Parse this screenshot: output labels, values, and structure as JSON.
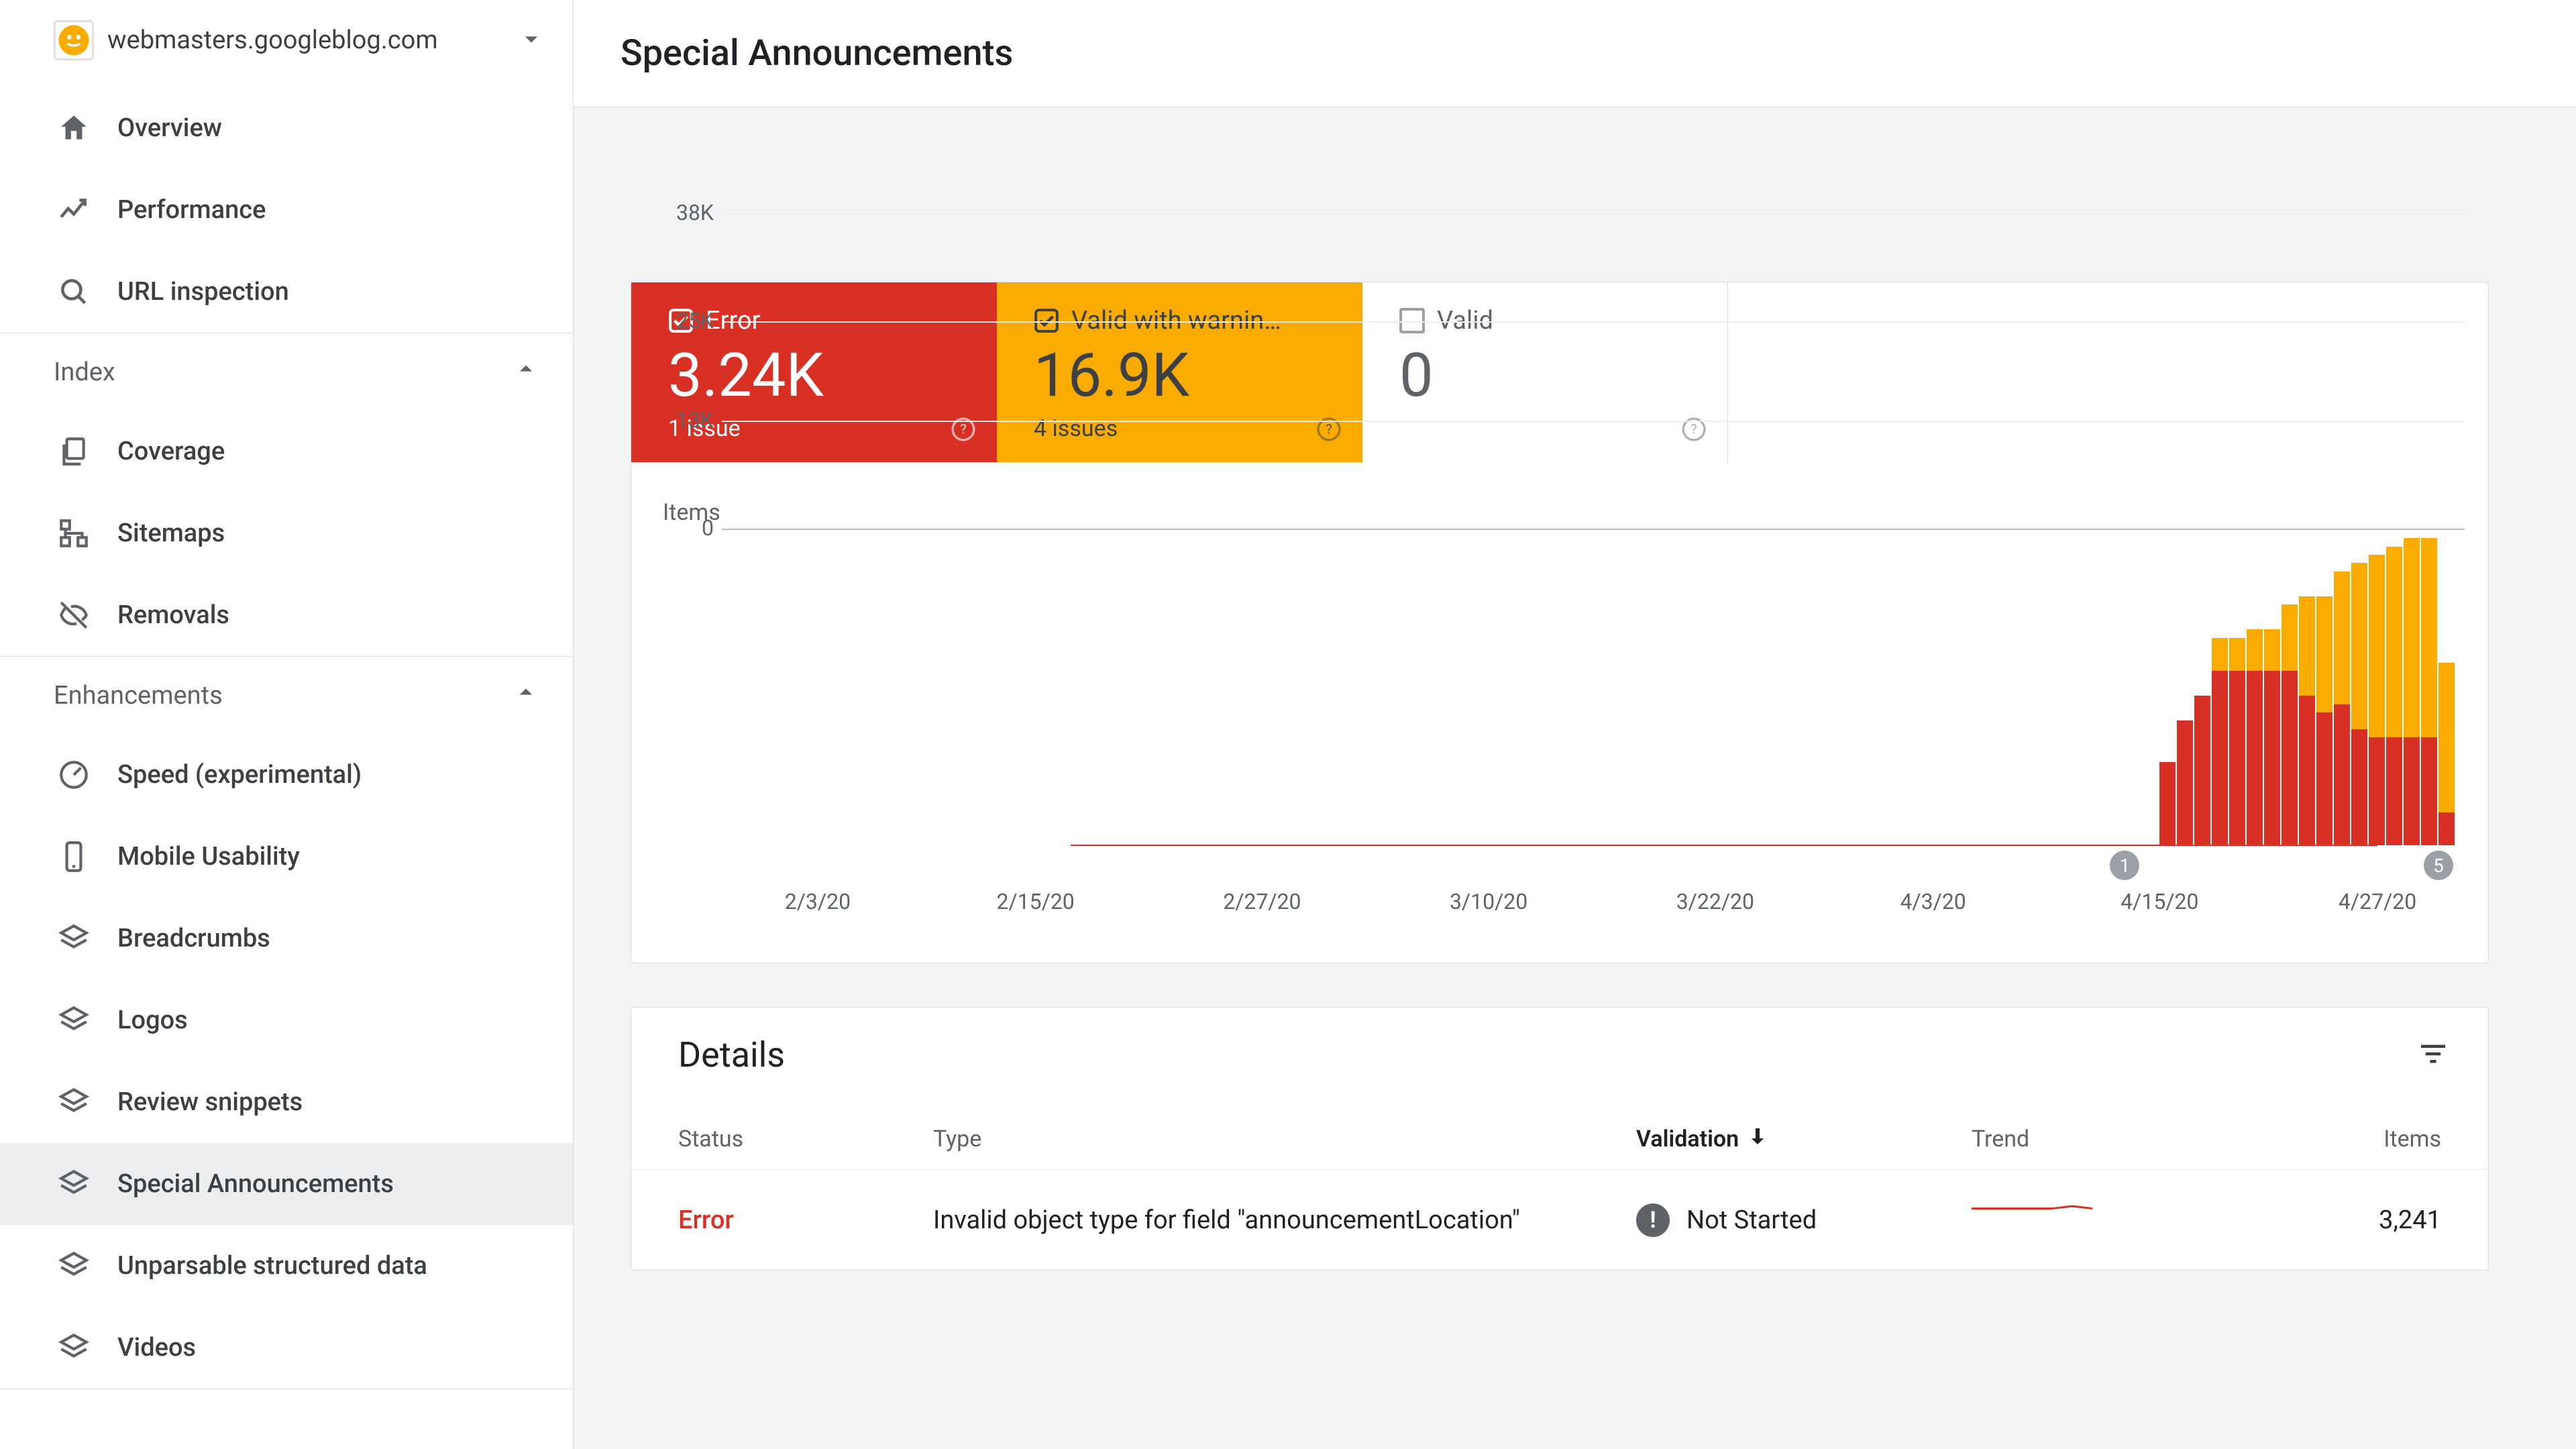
{
  "property": {
    "domain": "webmasters.googleblog.com"
  },
  "sidebar": {
    "primary": [
      {
        "id": "overview",
        "label": "Overview",
        "icon": "home"
      },
      {
        "id": "performance",
        "label": "Performance",
        "icon": "trend"
      },
      {
        "id": "url",
        "label": "URL inspection",
        "icon": "search"
      }
    ],
    "sections": [
      {
        "title": "Index",
        "items": [
          {
            "id": "coverage",
            "label": "Coverage",
            "icon": "pages"
          },
          {
            "id": "sitemaps",
            "label": "Sitemaps",
            "icon": "tree"
          },
          {
            "id": "removals",
            "label": "Removals",
            "icon": "hidden"
          }
        ]
      },
      {
        "title": "Enhancements",
        "items": [
          {
            "id": "speed",
            "label": "Speed (experimental)",
            "icon": "gauge"
          },
          {
            "id": "mobile",
            "label": "Mobile Usability",
            "icon": "phone"
          },
          {
            "id": "bread",
            "label": "Breadcrumbs",
            "icon": "layers"
          },
          {
            "id": "logos",
            "label": "Logos",
            "icon": "layers"
          },
          {
            "id": "review",
            "label": "Review snippets",
            "icon": "layers"
          },
          {
            "id": "special",
            "label": "Special Announcements",
            "icon": "layers",
            "active": true
          },
          {
            "id": "unparse",
            "label": "Unparsable structured data",
            "icon": "layers"
          },
          {
            "id": "videos",
            "label": "Videos",
            "icon": "layers"
          }
        ]
      }
    ]
  },
  "page": {
    "title": "Special Announcements"
  },
  "summary": {
    "error": {
      "label": "Error",
      "value": "3.24K",
      "sub": "1 issue",
      "checked": true
    },
    "warning": {
      "label": "Valid with warnin…",
      "value": "16.9K",
      "sub": "4 issues",
      "checked": true
    },
    "valid": {
      "label": "Valid",
      "value": "0",
      "sub": "",
      "checked": false
    }
  },
  "chart_data": {
    "type": "bar",
    "title": "",
    "ylabel": "Items",
    "ylim": [
      0,
      38000
    ],
    "yticks": [
      {
        "v": 0,
        "l": "0"
      },
      {
        "v": 13000,
        "l": "13K"
      },
      {
        "v": 25000,
        "l": "25K"
      },
      {
        "v": 38000,
        "l": "38K"
      }
    ],
    "categories_span": {
      "start": "2/3/20",
      "end": "4/30/20"
    },
    "xticks": [
      "2/3/20",
      "2/15/20",
      "2/27/20",
      "3/10/20",
      "3/22/20",
      "4/3/20",
      "4/15/20",
      "4/27/20"
    ],
    "xtick_positions_pct": [
      5.5,
      18,
      31,
      44,
      57,
      69.5,
      82.5,
      95
    ],
    "markers": [
      {
        "label": "1",
        "pos_pct": 80.5
      },
      {
        "label": "5",
        "pos_pct": 98.5
      }
    ],
    "series": [
      {
        "name": "Error",
        "color": "#d93025"
      },
      {
        "name": "Valid with warnings",
        "color": "#f9ab00"
      }
    ],
    "stacked_days": [
      {
        "pos_pct": 82.5,
        "error": 10000,
        "warn": 0
      },
      {
        "pos_pct": 83.5,
        "error": 15000,
        "warn": 0
      },
      {
        "pos_pct": 84.5,
        "error": 18000,
        "warn": 0
      },
      {
        "pos_pct": 85.5,
        "error": 21000,
        "warn": 4000
      },
      {
        "pos_pct": 86.5,
        "error": 21000,
        "warn": 4000
      },
      {
        "pos_pct": 87.5,
        "error": 21000,
        "warn": 5000
      },
      {
        "pos_pct": 88.5,
        "error": 21000,
        "warn": 5000
      },
      {
        "pos_pct": 89.5,
        "error": 21000,
        "warn": 8000
      },
      {
        "pos_pct": 90.5,
        "error": 18000,
        "warn": 12000
      },
      {
        "pos_pct": 91.5,
        "error": 16000,
        "warn": 14000
      },
      {
        "pos_pct": 92.5,
        "error": 17000,
        "warn": 16000
      },
      {
        "pos_pct": 93.5,
        "error": 14000,
        "warn": 20000
      },
      {
        "pos_pct": 94.5,
        "error": 13000,
        "warn": 22000
      },
      {
        "pos_pct": 95.5,
        "error": 13000,
        "warn": 23000
      },
      {
        "pos_pct": 96.5,
        "error": 13000,
        "warn": 24000
      },
      {
        "pos_pct": 97.5,
        "error": 13000,
        "warn": 24000
      },
      {
        "pos_pct": 98.5,
        "error": 4000,
        "warn": 18000
      }
    ]
  },
  "details": {
    "title": "Details",
    "columns": {
      "status": "Status",
      "type": "Type",
      "validation": "Validation",
      "trend": "Trend",
      "items": "Items"
    },
    "sort_col": "validation",
    "rows": [
      {
        "status": "Error",
        "status_kind": "error",
        "type": "Invalid object type for field \"announcementLocation\"",
        "validation": "Not Started",
        "items": "3,241",
        "spark": [
          3200,
          3200,
          3200,
          3200,
          3200,
          3600,
          3200
        ]
      }
    ]
  }
}
